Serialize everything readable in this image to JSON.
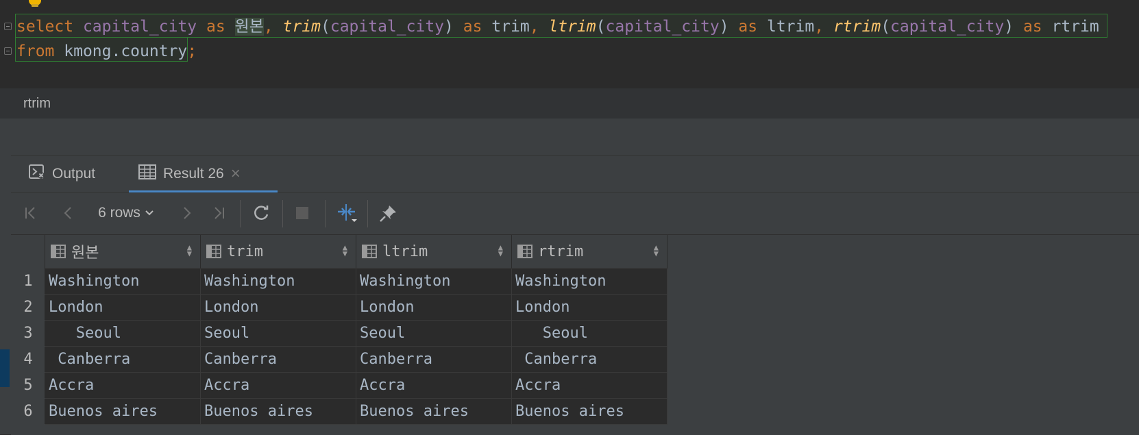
{
  "editor": {
    "line1": {
      "t1": "select",
      "t2": "capital_city",
      "t3": "as",
      "t4": "원본",
      "t5": ",",
      "t6": "trim",
      "t7": "(",
      "t8": "capital_city",
      "t9": ")",
      "t10": "as",
      "t11": "trim",
      "t12": ",",
      "t13": "ltrim",
      "t14": "(",
      "t15": "capital_city",
      "t16": ")",
      "t17": "as",
      "t18": "ltrim",
      "t19": ",",
      "t20": "rtrim",
      "t21": "(",
      "t22": "capital_city",
      "t23": ")",
      "t24": "as",
      "t25": "rtrim"
    },
    "line2": {
      "t1": "from",
      "t2": "kmong.country",
      "t3": ";"
    }
  },
  "status": {
    "text": "rtrim"
  },
  "tabs": [
    {
      "label": "Output",
      "icon": "console-icon"
    },
    {
      "label": "Result 26",
      "icon": "table-icon",
      "close": "×"
    }
  ],
  "toolbar": {
    "rows_label": "6 rows"
  },
  "grid": {
    "columns": [
      "원본",
      "trim",
      "ltrim",
      "rtrim"
    ],
    "rows": [
      {
        "n": "1",
        "v": [
          "Washington",
          "Washington",
          "Washington",
          "Washington"
        ]
      },
      {
        "n": "2",
        "v": [
          "London",
          "London",
          "London",
          "London"
        ]
      },
      {
        "n": "3",
        "v": [
          "   Seoul",
          "Seoul",
          "Seoul",
          "   Seoul"
        ]
      },
      {
        "n": "4",
        "v": [
          " Canberra",
          "Canberra",
          "Canberra",
          " Canberra"
        ]
      },
      {
        "n": "5",
        "v": [
          "Accra",
          "Accra",
          "Accra",
          "Accra"
        ]
      },
      {
        "n": "6",
        "v": [
          "Buenos aires",
          "Buenos aires",
          "Buenos aires",
          "Buenos aires"
        ]
      }
    ]
  },
  "colors": {
    "keyword": "#cc7832",
    "identifier": "#9876aa",
    "function": "#ffc66d",
    "accent": "#4a88c7"
  }
}
